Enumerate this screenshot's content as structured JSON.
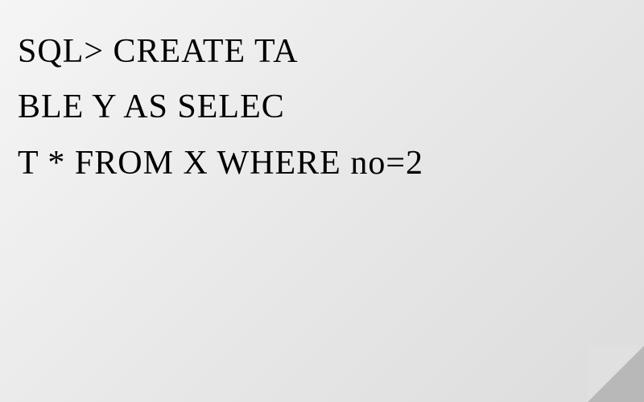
{
  "lines": {
    "line1": "SQL> CREATE TA",
    "line2": "BLE Y AS SELEC",
    "line3": "T * FROM X WHERE no=2"
  }
}
